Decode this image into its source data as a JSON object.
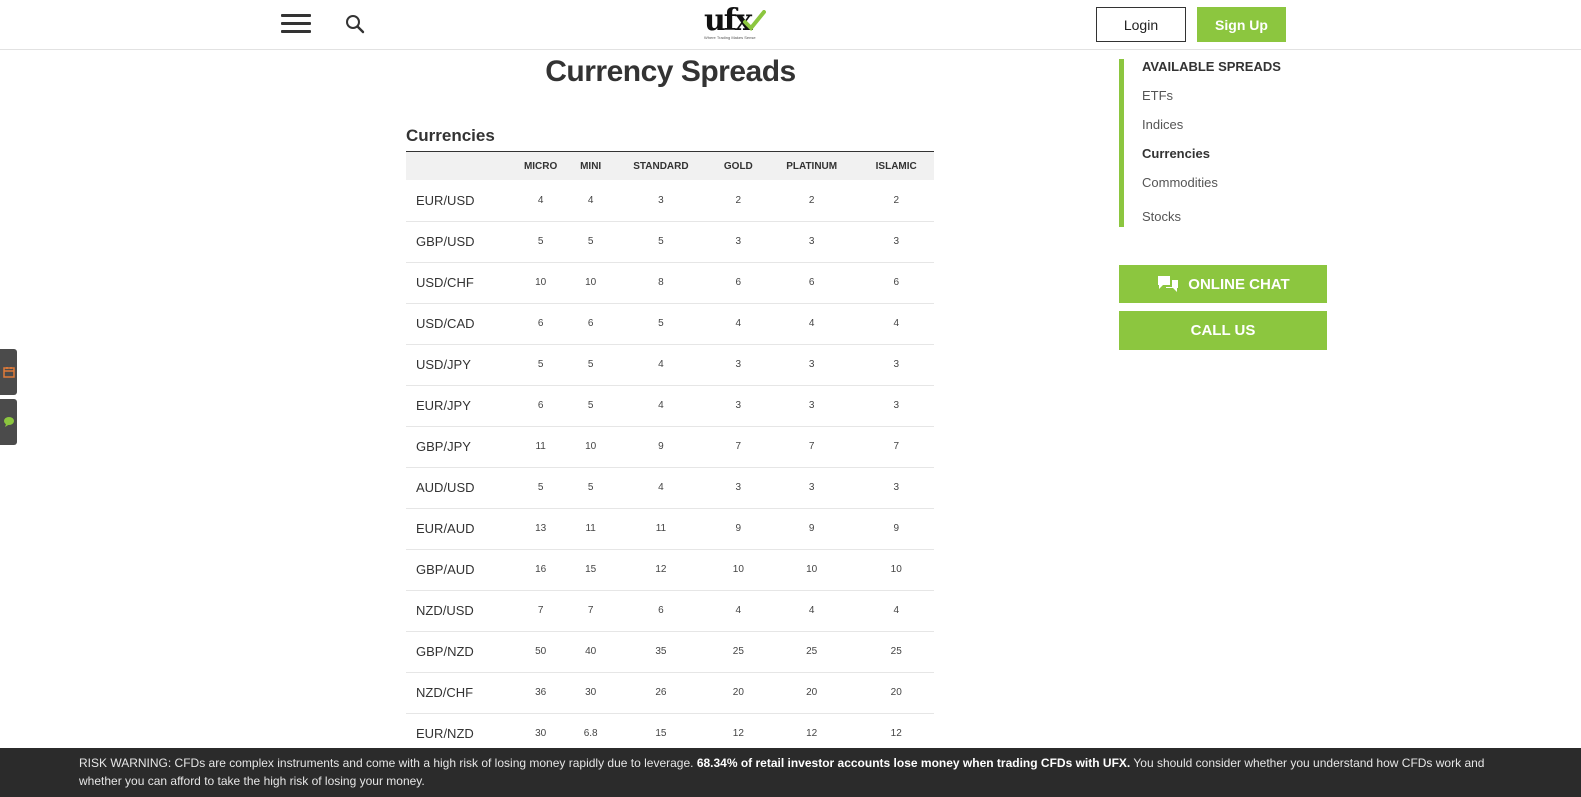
{
  "header": {
    "logo_text": "ufx",
    "logo_tagline": "Where Trading Makes Sense",
    "login_label": "Login",
    "signup_label": "Sign Up"
  },
  "page_title": "Currency Spreads",
  "section_title": "Currencies",
  "table": {
    "columns": [
      "MICRO",
      "MINI",
      "STANDARD",
      "GOLD",
      "PLATINUM",
      "ISLAMIC"
    ],
    "rows": [
      {
        "pair": "EUR/USD",
        "values": [
          "4",
          "4",
          "3",
          "2",
          "2",
          "2"
        ]
      },
      {
        "pair": "GBP/USD",
        "values": [
          "5",
          "5",
          "5",
          "3",
          "3",
          "3"
        ]
      },
      {
        "pair": "USD/CHF",
        "values": [
          "10",
          "10",
          "8",
          "6",
          "6",
          "6"
        ]
      },
      {
        "pair": "USD/CAD",
        "values": [
          "6",
          "6",
          "5",
          "4",
          "4",
          "4"
        ]
      },
      {
        "pair": "USD/JPY",
        "values": [
          "5",
          "5",
          "4",
          "3",
          "3",
          "3"
        ]
      },
      {
        "pair": "EUR/JPY",
        "values": [
          "6",
          "5",
          "4",
          "3",
          "3",
          "3"
        ]
      },
      {
        "pair": "GBP/JPY",
        "values": [
          "11",
          "10",
          "9",
          "7",
          "7",
          "7"
        ]
      },
      {
        "pair": "AUD/USD",
        "values": [
          "5",
          "5",
          "4",
          "3",
          "3",
          "3"
        ]
      },
      {
        "pair": "EUR/AUD",
        "values": [
          "13",
          "11",
          "11",
          "9",
          "9",
          "9"
        ]
      },
      {
        "pair": "GBP/AUD",
        "values": [
          "16",
          "15",
          "12",
          "10",
          "10",
          "10"
        ]
      },
      {
        "pair": "NZD/USD",
        "values": [
          "7",
          "7",
          "6",
          "4",
          "4",
          "4"
        ]
      },
      {
        "pair": "GBP/NZD",
        "values": [
          "50",
          "40",
          "35",
          "25",
          "25",
          "25"
        ]
      },
      {
        "pair": "NZD/CHF",
        "values": [
          "36",
          "30",
          "26",
          "20",
          "20",
          "20"
        ]
      },
      {
        "pair": "EUR/NZD",
        "values": [
          "30",
          "6.8",
          "15",
          "12",
          "12",
          "12"
        ]
      }
    ]
  },
  "sidebar": {
    "heading": "AVAILABLE SPREADS",
    "items": [
      {
        "label": "ETFs",
        "active": false
      },
      {
        "label": "Indices",
        "active": false
      },
      {
        "label": "Currencies",
        "active": true
      },
      {
        "label": "Commodities",
        "active": false
      },
      {
        "label": "Stocks",
        "active": false
      }
    ],
    "online_chat_label": "ONLINE CHAT",
    "call_us_label": "CALL US"
  },
  "risk_warning": {
    "part1": "RISK WARNING: CFDs are complex instruments and come with a high risk of losing money rapidly due to leverage. ",
    "bold": "68.34% of retail investor accounts lose money when trading CFDs with UFX.",
    "part2": " You should consider whether you understand how CFDs work and whether you can afford to take the high risk of losing your money."
  },
  "colors": {
    "accent": "#8cc63f",
    "dark_bar": "#2b2b2b",
    "float_tab": "#4b4b4b",
    "calendar_icon": "#e07b39",
    "chat_icon": "#8cc63f"
  },
  "icons": {
    "menu": "hamburger-menu-icon",
    "search": "search-icon",
    "chat": "chat-bubbles-icon",
    "calendar": "calendar-icon",
    "float_chat": "chat-icon"
  }
}
